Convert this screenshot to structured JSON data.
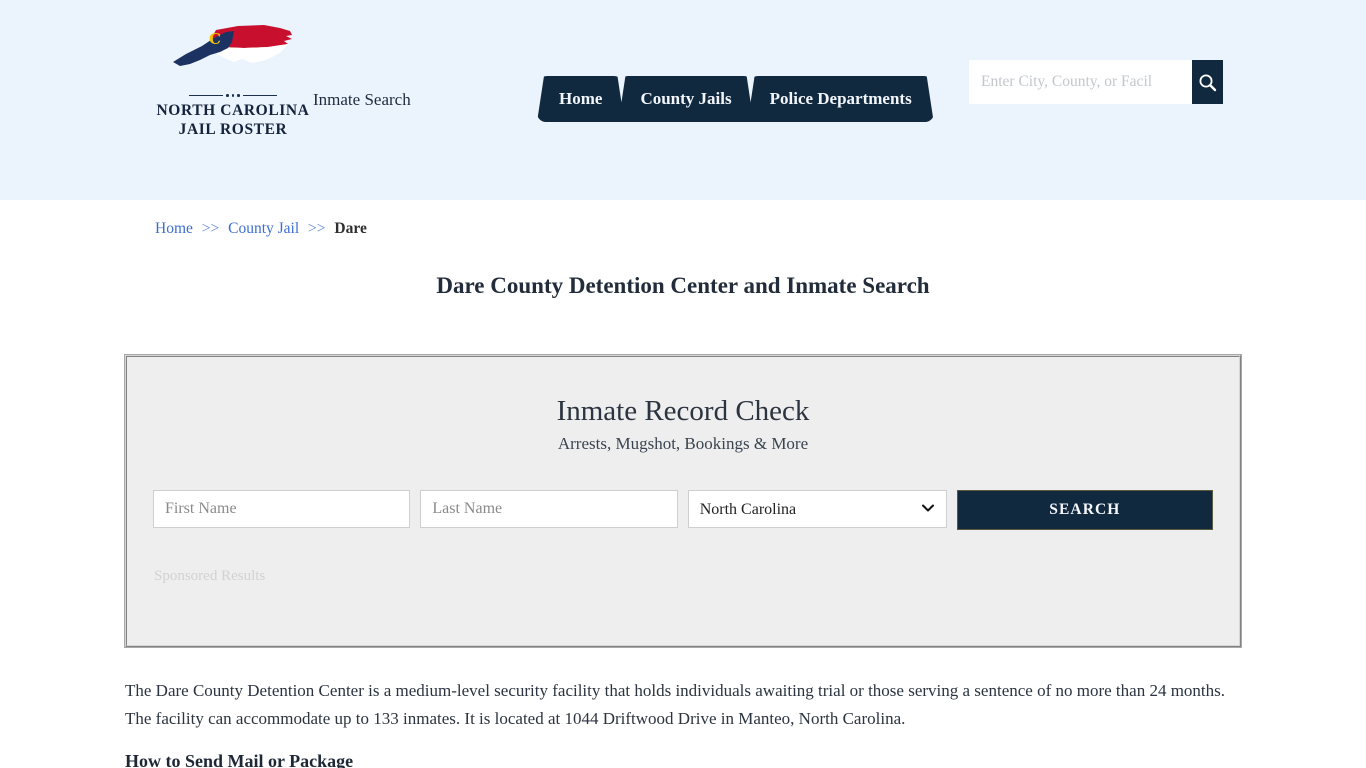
{
  "header": {
    "logo": {
      "line1": "NORTH CAROLINA",
      "line2": "JAIL ROSTER",
      "map_letter": "C",
      "colors": {
        "navy": "#1b3263",
        "red": "#c8102e",
        "white": "#ffffff"
      }
    },
    "tagline": "Inmate Search",
    "nav": [
      {
        "label": "Home"
      },
      {
        "label": "County Jails"
      },
      {
        "label": "Police Departments"
      }
    ],
    "search": {
      "placeholder": "Enter City, County, or Facil",
      "value": "",
      "icon": "search-icon"
    },
    "background": "#ebf3fd",
    "accent": "#10293f"
  },
  "breadcrumb": {
    "home": "Home",
    "sep": ">>",
    "county_jail": "County Jail",
    "current": "Dare"
  },
  "page_title": "Dare County Detention Center and Inmate Search",
  "record_check": {
    "title": "Inmate Record Check",
    "subtitle": "Arrests, Mugshot, Bookings & More",
    "first_name_placeholder": "First Name",
    "first_name_value": "",
    "last_name_placeholder": "Last Name",
    "last_name_value": "",
    "state_selected": "North Carolina",
    "state_options": [
      "North Carolina"
    ],
    "search_label": "SEARCH",
    "sponsored_label": "Sponsored Results"
  },
  "content": {
    "paragraph": "The Dare County Detention Center is a medium-level security facility that holds individuals awaiting trial or those serving a sentence of no more than 24 months. The facility can accommodate up to 133 inmates. It is located at 1044 Driftwood Drive in Manteo, North Carolina.",
    "next_heading": "How to Send Mail or Package"
  }
}
